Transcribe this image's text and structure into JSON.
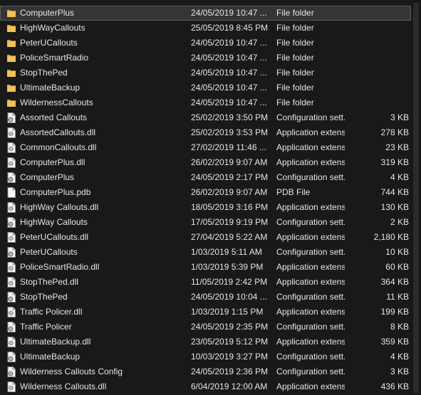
{
  "colors": {
    "background": "#191919",
    "text": "#e6e6e6",
    "selected_row": "#353535",
    "folder_icon": "#e8b24a"
  },
  "files": [
    {
      "name": "ComputerPlus",
      "date": "24/05/2019 10:47 ...",
      "type": "File folder",
      "size": "",
      "icon": "folder-icon",
      "selected": true
    },
    {
      "name": "HighWayCallouts",
      "date": "25/05/2019 8:45 PM",
      "type": "File folder",
      "size": "",
      "icon": "folder-icon"
    },
    {
      "name": "PeterUCallouts",
      "date": "24/05/2019 10:47 ...",
      "type": "File folder",
      "size": "",
      "icon": "folder-icon"
    },
    {
      "name": "PoliceSmartRadio",
      "date": "24/05/2019 10:47 ...",
      "type": "File folder",
      "size": "",
      "icon": "folder-icon"
    },
    {
      "name": "StopThePed",
      "date": "24/05/2019 10:47 ...",
      "type": "File folder",
      "size": "",
      "icon": "folder-icon"
    },
    {
      "name": "UltimateBackup",
      "date": "24/05/2019 10:47 ...",
      "type": "File folder",
      "size": "",
      "icon": "folder-icon"
    },
    {
      "name": "WildernessCallouts",
      "date": "24/05/2019 10:47 ...",
      "type": "File folder",
      "size": "",
      "icon": "folder-icon"
    },
    {
      "name": "Assorted Callouts",
      "date": "25/02/2019 3:50 PM",
      "type": "Configuration sett...",
      "size": "3 KB",
      "icon": "config-file-icon"
    },
    {
      "name": "AssortedCallouts.dll",
      "date": "25/02/2019 3:53 PM",
      "type": "Application extens...",
      "size": "278 KB",
      "icon": "dll-file-icon"
    },
    {
      "name": "CommonCallouts.dll",
      "date": "27/02/2019 11:46 ...",
      "type": "Application extens...",
      "size": "23 KB",
      "icon": "dll-file-icon"
    },
    {
      "name": "ComputerPlus.dll",
      "date": "26/02/2019 9:07 AM",
      "type": "Application extens...",
      "size": "319 KB",
      "icon": "dll-file-icon"
    },
    {
      "name": "ComputerPlus",
      "date": "24/05/2019 2:17 PM",
      "type": "Configuration sett...",
      "size": "4 KB",
      "icon": "config-file-icon"
    },
    {
      "name": "ComputerPlus.pdb",
      "date": "26/02/2019 9:07 AM",
      "type": "PDB File",
      "size": "744 KB",
      "icon": "blank-file-icon"
    },
    {
      "name": "HighWay Callouts.dll",
      "date": "18/05/2019 3:16 PM",
      "type": "Application extens...",
      "size": "130 KB",
      "icon": "dll-file-icon"
    },
    {
      "name": "HighWay Callouts",
      "date": "17/05/2019 9:19 PM",
      "type": "Configuration sett...",
      "size": "2 KB",
      "icon": "config-file-icon"
    },
    {
      "name": "PeterUCallouts.dll",
      "date": "27/04/2019 5:22 AM",
      "type": "Application extens...",
      "size": "2,180 KB",
      "icon": "dll-file-icon"
    },
    {
      "name": "PeterUCallouts",
      "date": "1/03/2019 5:11 AM",
      "type": "Configuration sett...",
      "size": "10 KB",
      "icon": "config-file-icon"
    },
    {
      "name": "PoliceSmartRadio.dll",
      "date": "1/03/2019 5:39 PM",
      "type": "Application extens...",
      "size": "60 KB",
      "icon": "dll-file-icon"
    },
    {
      "name": "StopThePed.dll",
      "date": "11/05/2019 2:42 PM",
      "type": "Application extens...",
      "size": "364 KB",
      "icon": "dll-file-icon"
    },
    {
      "name": "StopThePed",
      "date": "24/05/2019 10:04 ...",
      "type": "Configuration sett...",
      "size": "11 KB",
      "icon": "config-file-icon"
    },
    {
      "name": "Traffic Policer.dll",
      "date": "1/03/2019 1:15 PM",
      "type": "Application extens...",
      "size": "199 KB",
      "icon": "dll-file-icon"
    },
    {
      "name": "Traffic Policer",
      "date": "24/05/2019 2:35 PM",
      "type": "Configuration sett...",
      "size": "8 KB",
      "icon": "config-file-icon"
    },
    {
      "name": "UltimateBackup.dll",
      "date": "23/05/2019 5:12 PM",
      "type": "Application extens...",
      "size": "359 KB",
      "icon": "dll-file-icon"
    },
    {
      "name": "UltimateBackup",
      "date": "10/03/2019 3:27 PM",
      "type": "Configuration sett...",
      "size": "4 KB",
      "icon": "config-file-icon"
    },
    {
      "name": "Wilderness Callouts Config",
      "date": "24/05/2019 2:36 PM",
      "type": "Configuration sett...",
      "size": "3 KB",
      "icon": "config-file-icon"
    },
    {
      "name": "Wilderness Callouts.dll",
      "date": "6/04/2019 12:00 AM",
      "type": "Application extens...",
      "size": "436 KB",
      "icon": "dll-file-icon"
    }
  ]
}
